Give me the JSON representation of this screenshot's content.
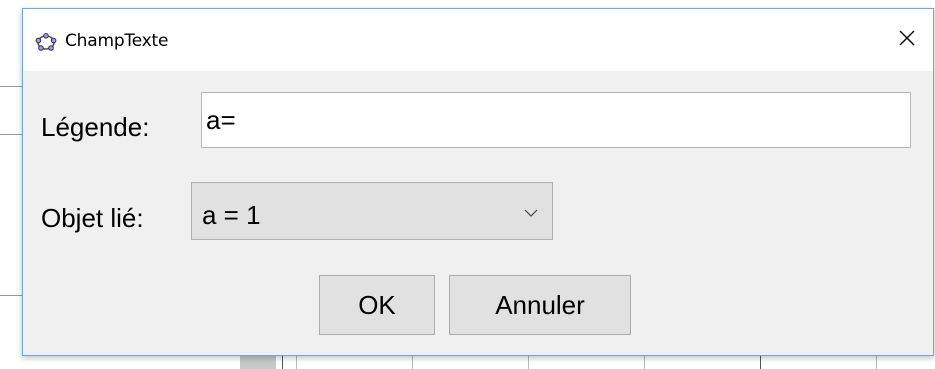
{
  "window": {
    "title": "ChampTexte",
    "close_icon": "close-icon",
    "app_icon": "geogebra-icon"
  },
  "form": {
    "caption_label": "Légende:",
    "caption_value": "a=",
    "linked_object_label": "Objet lié:",
    "linked_object_value": "a = 1"
  },
  "buttons": {
    "ok_label": "OK",
    "cancel_label": "Annuler"
  },
  "colors": {
    "dialog_border": "#6fa7dd",
    "dialog_bg": "#f0f0f0",
    "button_bg": "#e1e1e1"
  }
}
